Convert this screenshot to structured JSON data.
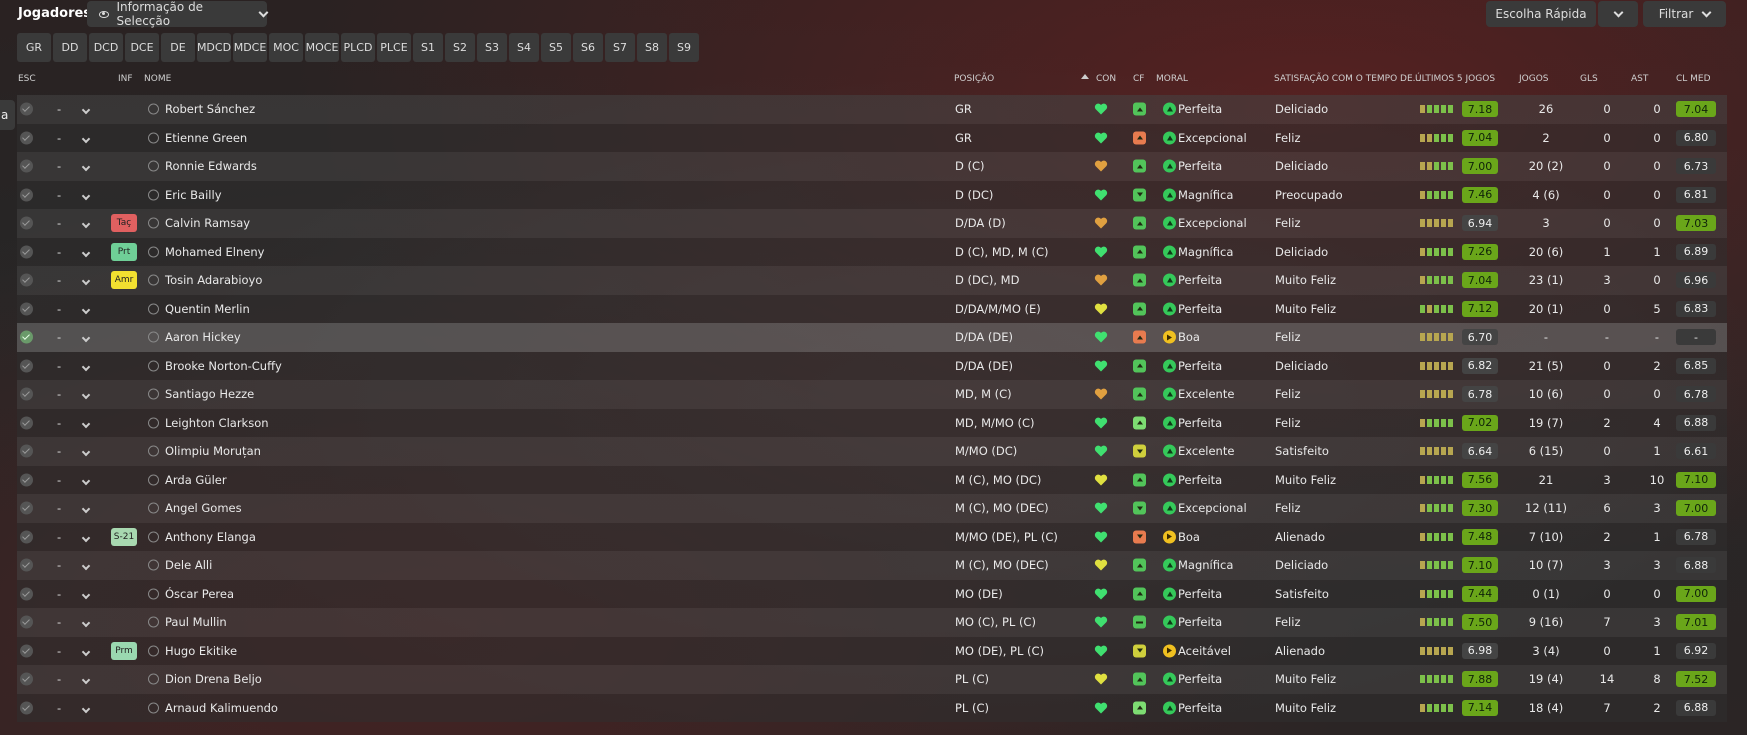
{
  "header": {
    "title": "Jogadores",
    "view_select": "Informação de Selecção",
    "quick_pick": "Escolha Rápida",
    "filter": "Filtrar"
  },
  "side_tab": "a",
  "position_filters": [
    "GR",
    "DD",
    "DCD",
    "DCE",
    "DE",
    "MDCD",
    "MDCE",
    "MOC",
    "MOCE",
    "PLCD",
    "PLCE",
    "S1",
    "S2",
    "S3",
    "S4",
    "S5",
    "S6",
    "S7",
    "S8",
    "S9"
  ],
  "columns": {
    "esc": "ESC",
    "inf": "INF",
    "nome": "NOME",
    "posicao": "POSIÇÃO",
    "con": "CON",
    "cf": "CF",
    "moral": "MORAL",
    "satisfacao": "SATISFAÇÃO COM O TEMPO DE...",
    "ultimos": "ÚLTIMOS 5 JOGOS",
    "jogos": "JOGOS",
    "gls": "GLS",
    "ast": "AST",
    "clmed": "CL MED"
  },
  "colors": {
    "badge_taq": "#e06060",
    "badge_prt": "#6fcf97",
    "badge_amr": "#f2e030",
    "badge_s21": "#a8d8b0",
    "badge_prm": "#9ad8b0",
    "heart_green": "#40e070",
    "heart_yellow": "#e0e040",
    "heart_orange": "#e0a040",
    "rating_green": "#6aa61a"
  },
  "players": [
    {
      "name": "Robert Sánchez",
      "pos": "GR",
      "con": "green",
      "cf": "up-g",
      "moral_icon": "g",
      "moral": "Perfeita",
      "sat": "Deliciado",
      "form": [
        0,
        1,
        1,
        1,
        1
      ],
      "rating": "7.18",
      "rating_good": true,
      "jogos": "26",
      "gls": "0",
      "ast": "0",
      "clmed": "7.04",
      "clmed_good": true,
      "badge": "",
      "checked": false,
      "dash": "-"
    },
    {
      "name": "Etienne Green",
      "pos": "GR",
      "con": "green",
      "cf": "up-o",
      "moral_icon": "g",
      "moral": "Excepcional",
      "sat": "Feliz",
      "form": [
        0,
        0,
        1,
        1,
        1
      ],
      "rating": "7.04",
      "rating_good": true,
      "jogos": "2",
      "gls": "0",
      "ast": "0",
      "clmed": "6.80",
      "clmed_good": false,
      "badge": "",
      "checked": false,
      "dash": "-"
    },
    {
      "name": "Ronnie Edwards",
      "pos": "D (C)",
      "con": "orange",
      "cf": "up-g",
      "moral_icon": "g",
      "moral": "Perfeita",
      "sat": "Deliciado",
      "form": [
        0,
        0,
        1,
        1,
        1
      ],
      "rating": "7.00",
      "rating_good": true,
      "jogos": "20 (2)",
      "gls": "0",
      "ast": "0",
      "clmed": "6.73",
      "clmed_good": false,
      "badge": "",
      "checked": false,
      "dash": "-"
    },
    {
      "name": "Eric Bailly",
      "pos": "D (DC)",
      "con": "green",
      "cf": "down-g",
      "moral_icon": "g",
      "moral": "Magnífica",
      "sat": "Preocupado",
      "form": [
        0,
        1,
        1,
        1,
        1
      ],
      "rating": "7.46",
      "rating_good": true,
      "jogos": "4 (6)",
      "gls": "0",
      "ast": "0",
      "clmed": "6.81",
      "clmed_good": false,
      "badge": "",
      "checked": false,
      "dash": "-"
    },
    {
      "name": "Calvin Ramsay",
      "pos": "D/DA (D)",
      "con": "orange",
      "cf": "up-g",
      "moral_icon": "g",
      "moral": "Excepcional",
      "sat": "Feliz",
      "form": [
        0,
        0,
        0,
        0,
        0
      ],
      "rating": "6.94",
      "rating_good": false,
      "jogos": "3",
      "gls": "0",
      "ast": "0",
      "clmed": "7.03",
      "clmed_good": true,
      "badge": "Taç",
      "badge_color": "#e06060",
      "checked": false,
      "dash": "-"
    },
    {
      "name": "Mohamed Elneny",
      "pos": "D (C), MD, M (C)",
      "con": "green",
      "cf": "up-g",
      "moral_icon": "g",
      "moral": "Magnífica",
      "sat": "Deliciado",
      "form": [
        0,
        1,
        1,
        1,
        1
      ],
      "rating": "7.26",
      "rating_good": true,
      "jogos": "20 (6)",
      "gls": "1",
      "ast": "1",
      "clmed": "6.89",
      "clmed_good": false,
      "badge": "Prt",
      "badge_color": "#6fcf97",
      "checked": false,
      "dash": "-"
    },
    {
      "name": "Tosin Adarabioyo",
      "pos": "D (DC), MD",
      "con": "orange",
      "cf": "up-g",
      "moral_icon": "g",
      "moral": "Perfeita",
      "sat": "Muito Feliz",
      "form": [
        0,
        1,
        1,
        1,
        1
      ],
      "rating": "7.04",
      "rating_good": true,
      "jogos": "23 (1)",
      "gls": "3",
      "ast": "0",
      "clmed": "6.96",
      "clmed_good": false,
      "badge": "Amr",
      "badge_color": "#f2e030",
      "checked": false,
      "dash": "-"
    },
    {
      "name": "Quentin Merlin",
      "pos": "D/DA/M/MO (E)",
      "con": "yellow",
      "cf": "up-g",
      "moral_icon": "g",
      "moral": "Perfeita",
      "sat": "Muito Feliz",
      "form": [
        1,
        0,
        1,
        1,
        1
      ],
      "rating": "7.12",
      "rating_good": true,
      "jogos": "20 (1)",
      "gls": "0",
      "ast": "5",
      "clmed": "6.83",
      "clmed_good": false,
      "badge": "",
      "checked": false,
      "dash": "-"
    },
    {
      "name": "Aaron Hickey",
      "pos": "D/DA (DE)",
      "con": "green",
      "cf": "up-o",
      "moral_icon": "y",
      "moral": "Boa",
      "sat": "Feliz",
      "form": [
        0,
        0,
        0,
        0,
        0
      ],
      "rating": "6.70",
      "rating_good": false,
      "jogos": "-",
      "gls": "-",
      "ast": "-",
      "clmed": "-",
      "clmed_good": false,
      "badge": "",
      "checked": true,
      "dash": "-",
      "hl": true
    },
    {
      "name": "Brooke Norton-Cuffy",
      "pos": "D/DA (DE)",
      "con": "green",
      "cf": "up-g",
      "moral_icon": "g",
      "moral": "Perfeita",
      "sat": "Deliciado",
      "form": [
        0,
        0,
        0,
        0,
        0
      ],
      "rating": "6.82",
      "rating_good": false,
      "jogos": "21 (5)",
      "gls": "0",
      "ast": "2",
      "clmed": "6.85",
      "clmed_good": false,
      "badge": "",
      "checked": false,
      "dash": "-"
    },
    {
      "name": "Santiago Hezze",
      "pos": "MD, M (C)",
      "con": "orange",
      "cf": "up-g",
      "moral_icon": "g",
      "moral": "Excelente",
      "sat": "Feliz",
      "form": [
        0,
        0,
        0,
        0,
        0
      ],
      "rating": "6.78",
      "rating_good": false,
      "jogos": "10 (6)",
      "gls": "0",
      "ast": "0",
      "clmed": "6.78",
      "clmed_good": false,
      "badge": "",
      "checked": false,
      "dash": "-"
    },
    {
      "name": "Leighton Clarkson",
      "pos": "MD, M/MO (C)",
      "con": "green",
      "cf": "up-bright",
      "moral_icon": "g",
      "moral": "Perfeita",
      "sat": "Feliz",
      "form": [
        0,
        1,
        1,
        1,
        1
      ],
      "rating": "7.02",
      "rating_good": true,
      "jogos": "19 (7)",
      "gls": "2",
      "ast": "4",
      "clmed": "6.88",
      "clmed_good": false,
      "badge": "",
      "checked": false,
      "dash": "-"
    },
    {
      "name": "Olimpiu Moruțan",
      "pos": "M/MO (DC)",
      "con": "green",
      "cf": "down-y",
      "moral_icon": "g",
      "moral": "Excelente",
      "sat": "Satisfeito",
      "form": [
        0,
        0,
        0,
        0,
        0
      ],
      "rating": "6.64",
      "rating_good": false,
      "jogos": "6 (15)",
      "gls": "0",
      "ast": "1",
      "clmed": "6.61",
      "clmed_good": false,
      "badge": "",
      "checked": false,
      "dash": "-"
    },
    {
      "name": "Arda Güler",
      "pos": "M (C), MO (DC)",
      "con": "yellow",
      "cf": "up-g",
      "moral_icon": "g",
      "moral": "Perfeita",
      "sat": "Muito Feliz",
      "form": [
        0,
        1,
        1,
        1,
        1
      ],
      "rating": "7.56",
      "rating_good": true,
      "jogos": "21",
      "gls": "3",
      "ast": "10",
      "clmed": "7.10",
      "clmed_good": true,
      "badge": "",
      "checked": false,
      "dash": "-"
    },
    {
      "name": "Angel Gomes",
      "pos": "M (C), MO (DEC)",
      "con": "green",
      "cf": "down-g",
      "moral_icon": "g",
      "moral": "Excepcional",
      "sat": "Feliz",
      "form": [
        0,
        1,
        1,
        1,
        1
      ],
      "rating": "7.30",
      "rating_good": true,
      "jogos": "12 (11)",
      "gls": "6",
      "ast": "3",
      "clmed": "7.00",
      "clmed_good": true,
      "badge": "",
      "checked": false,
      "dash": "-"
    },
    {
      "name": "Anthony Elanga",
      "pos": "M/MO (DE), PL (C)",
      "con": "green",
      "cf": "down-o",
      "moral_icon": "y",
      "moral": "Boa",
      "sat": "Alienado",
      "form": [
        0,
        1,
        1,
        1,
        1
      ],
      "rating": "7.48",
      "rating_good": true,
      "jogos": "7 (10)",
      "gls": "2",
      "ast": "1",
      "clmed": "6.78",
      "clmed_good": false,
      "badge": "S-21",
      "badge_color": "#a8d8b0",
      "checked": false,
      "dash": "-"
    },
    {
      "name": "Dele Alli",
      "pos": "M (C), MO (DEC)",
      "con": "yellow",
      "cf": "up-g",
      "moral_icon": "g",
      "moral": "Magnífica",
      "sat": "Deliciado",
      "form": [
        0,
        1,
        1,
        1,
        1
      ],
      "rating": "7.10",
      "rating_good": true,
      "jogos": "10 (7)",
      "gls": "3",
      "ast": "3",
      "clmed": "6.88",
      "clmed_good": false,
      "badge": "",
      "checked": false,
      "dash": "-"
    },
    {
      "name": "Óscar Perea",
      "pos": "MO (DE)",
      "con": "green",
      "cf": "up-g",
      "moral_icon": "g",
      "moral": "Perfeita",
      "sat": "Satisfeito",
      "form": [
        0,
        1,
        1,
        1,
        1
      ],
      "rating": "7.44",
      "rating_good": true,
      "jogos": "0 (1)",
      "gls": "0",
      "ast": "0",
      "clmed": "7.00",
      "clmed_good": true,
      "badge": "",
      "checked": false,
      "dash": "-"
    },
    {
      "name": "Paul Mullin",
      "pos": "MO (C), PL (C)",
      "con": "green",
      "cf": "flat-g",
      "moral_icon": "g",
      "moral": "Perfeita",
      "sat": "Feliz",
      "form": [
        0,
        1,
        1,
        1,
        1
      ],
      "rating": "7.50",
      "rating_good": true,
      "jogos": "9 (16)",
      "gls": "7",
      "ast": "3",
      "clmed": "7.01",
      "clmed_good": true,
      "badge": "",
      "checked": false,
      "dash": "-"
    },
    {
      "name": "Hugo Ekitike",
      "pos": "MO (DE), PL (C)",
      "con": "green",
      "cf": "down-y",
      "moral_icon": "y",
      "moral": "Aceitável",
      "sat": "Alienado",
      "form": [
        0,
        0,
        0,
        0,
        0
      ],
      "rating": "6.98",
      "rating_good": false,
      "jogos": "3 (4)",
      "gls": "0",
      "ast": "1",
      "clmed": "6.92",
      "clmed_good": false,
      "badge": "Prm",
      "badge_color": "#9ad8b0",
      "checked": false,
      "dash": "-"
    },
    {
      "name": "Dion Drena Beljo",
      "pos": "PL (C)",
      "con": "yellow",
      "cf": "up-g",
      "moral_icon": "g",
      "moral": "Perfeita",
      "sat": "Muito Feliz",
      "form": [
        1,
        1,
        1,
        1,
        1
      ],
      "rating": "7.88",
      "rating_good": true,
      "jogos": "19 (4)",
      "gls": "14",
      "ast": "8",
      "clmed": "7.52",
      "clmed_good": true,
      "badge": "",
      "checked": false,
      "dash": "-"
    },
    {
      "name": "Arnaud Kalimuendo",
      "pos": "PL (C)",
      "con": "green",
      "cf": "up-bright",
      "moral_icon": "g",
      "moral": "Perfeita",
      "sat": "Muito Feliz",
      "form": [
        0,
        1,
        1,
        1,
        1
      ],
      "rating": "7.14",
      "rating_good": true,
      "jogos": "18 (4)",
      "gls": "7",
      "ast": "2",
      "clmed": "6.88",
      "clmed_good": false,
      "badge": "",
      "checked": false,
      "dash": "-"
    }
  ]
}
